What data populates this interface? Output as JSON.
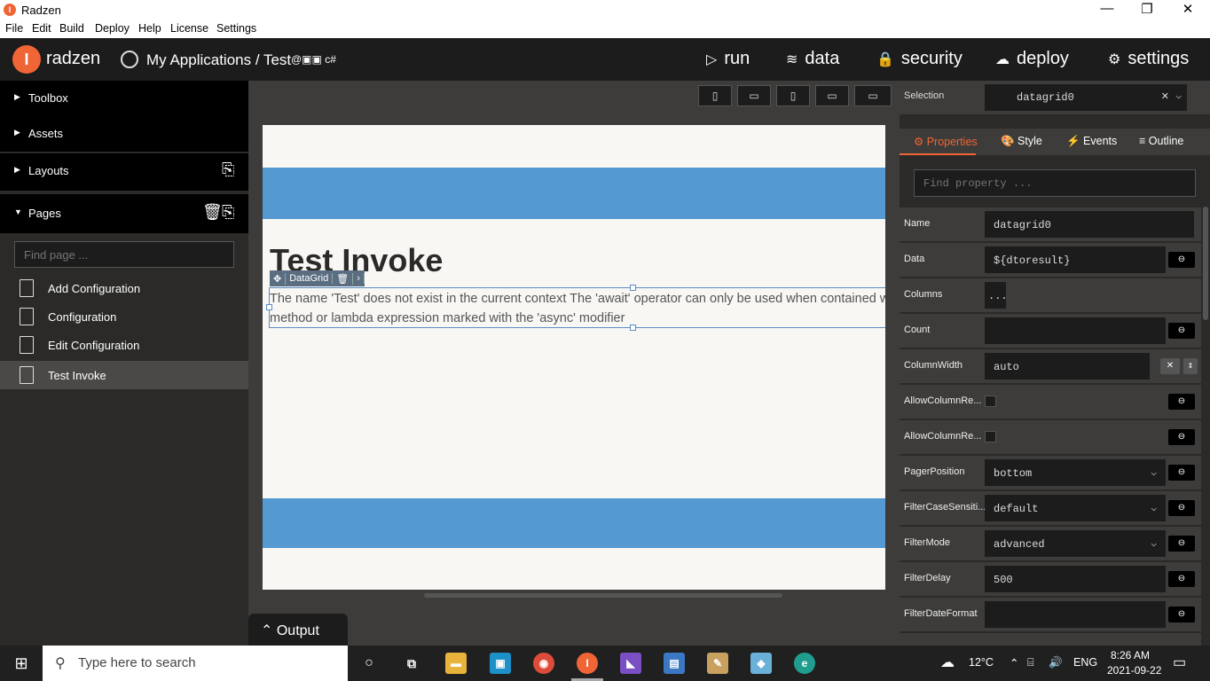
{
  "window": {
    "title": "Radzen",
    "minimize": "—",
    "maximize": "❐",
    "close": "✕"
  },
  "menu": [
    "File",
    "Edit",
    "Build",
    "Deploy",
    "Help",
    "License",
    "Settings"
  ],
  "topbar": {
    "brand": "radzen",
    "logo_letter": "I",
    "breadcrumb": "My Applications / Test",
    "tech": "@▣▣ c#",
    "nav": [
      {
        "label": "run",
        "icon": "▷"
      },
      {
        "label": "data",
        "icon": "≋"
      },
      {
        "label": "security",
        "icon": "🔒"
      },
      {
        "label": "deploy",
        "icon": "☁"
      },
      {
        "label": "settings",
        "icon": "⚙"
      }
    ]
  },
  "sidebar": {
    "sections": [
      "Toolbox",
      "Assets",
      "Layouts",
      "Pages"
    ],
    "page_search_placeholder": "Find page ...",
    "pages": [
      "Add Configuration",
      "Configuration",
      "Edit Configuration",
      "Test Invoke"
    ],
    "selected_page": "Test Invoke"
  },
  "canvas": {
    "page_title": "Test Invoke",
    "component_tag": "DataGrid",
    "error_text": "The name 'Test' does not exist in the current context The 'await' operator can only be used when contained within a method or lambda expression marked with the 'async' modifier",
    "output_label": "Output",
    "band_color": "#5499d1"
  },
  "inspector": {
    "selection_label": "Selection",
    "selection_value": "datagrid0",
    "tabs": [
      "Properties",
      "Style",
      "Events",
      "Outline"
    ],
    "active_tab": "Properties",
    "find_placeholder": "Find property ...",
    "properties": [
      {
        "name": "Name",
        "value": "datagrid0"
      },
      {
        "name": "Data",
        "value": "${dtoresult}"
      },
      {
        "name": "Columns",
        "value": "..."
      },
      {
        "name": "Count",
        "value": ""
      },
      {
        "name": "ColumnWidth",
        "value": "auto"
      },
      {
        "name": "AllowColumnRe...",
        "value": ""
      },
      {
        "name": "AllowColumnRe...",
        "value": ""
      },
      {
        "name": "PagerPosition",
        "value": "bottom"
      },
      {
        "name": "FilterCaseSensiti...",
        "value": "default"
      },
      {
        "name": "FilterMode",
        "value": "advanced"
      },
      {
        "name": "FilterDelay",
        "value": "500"
      },
      {
        "name": "FilterDateFormat",
        "value": ""
      }
    ],
    "accent": "#f06535"
  },
  "taskbar": {
    "search_placeholder": "Type here to search",
    "weather": "12°C",
    "lang": "ENG",
    "time": "8:26 AM",
    "date": "2021-09-22"
  }
}
